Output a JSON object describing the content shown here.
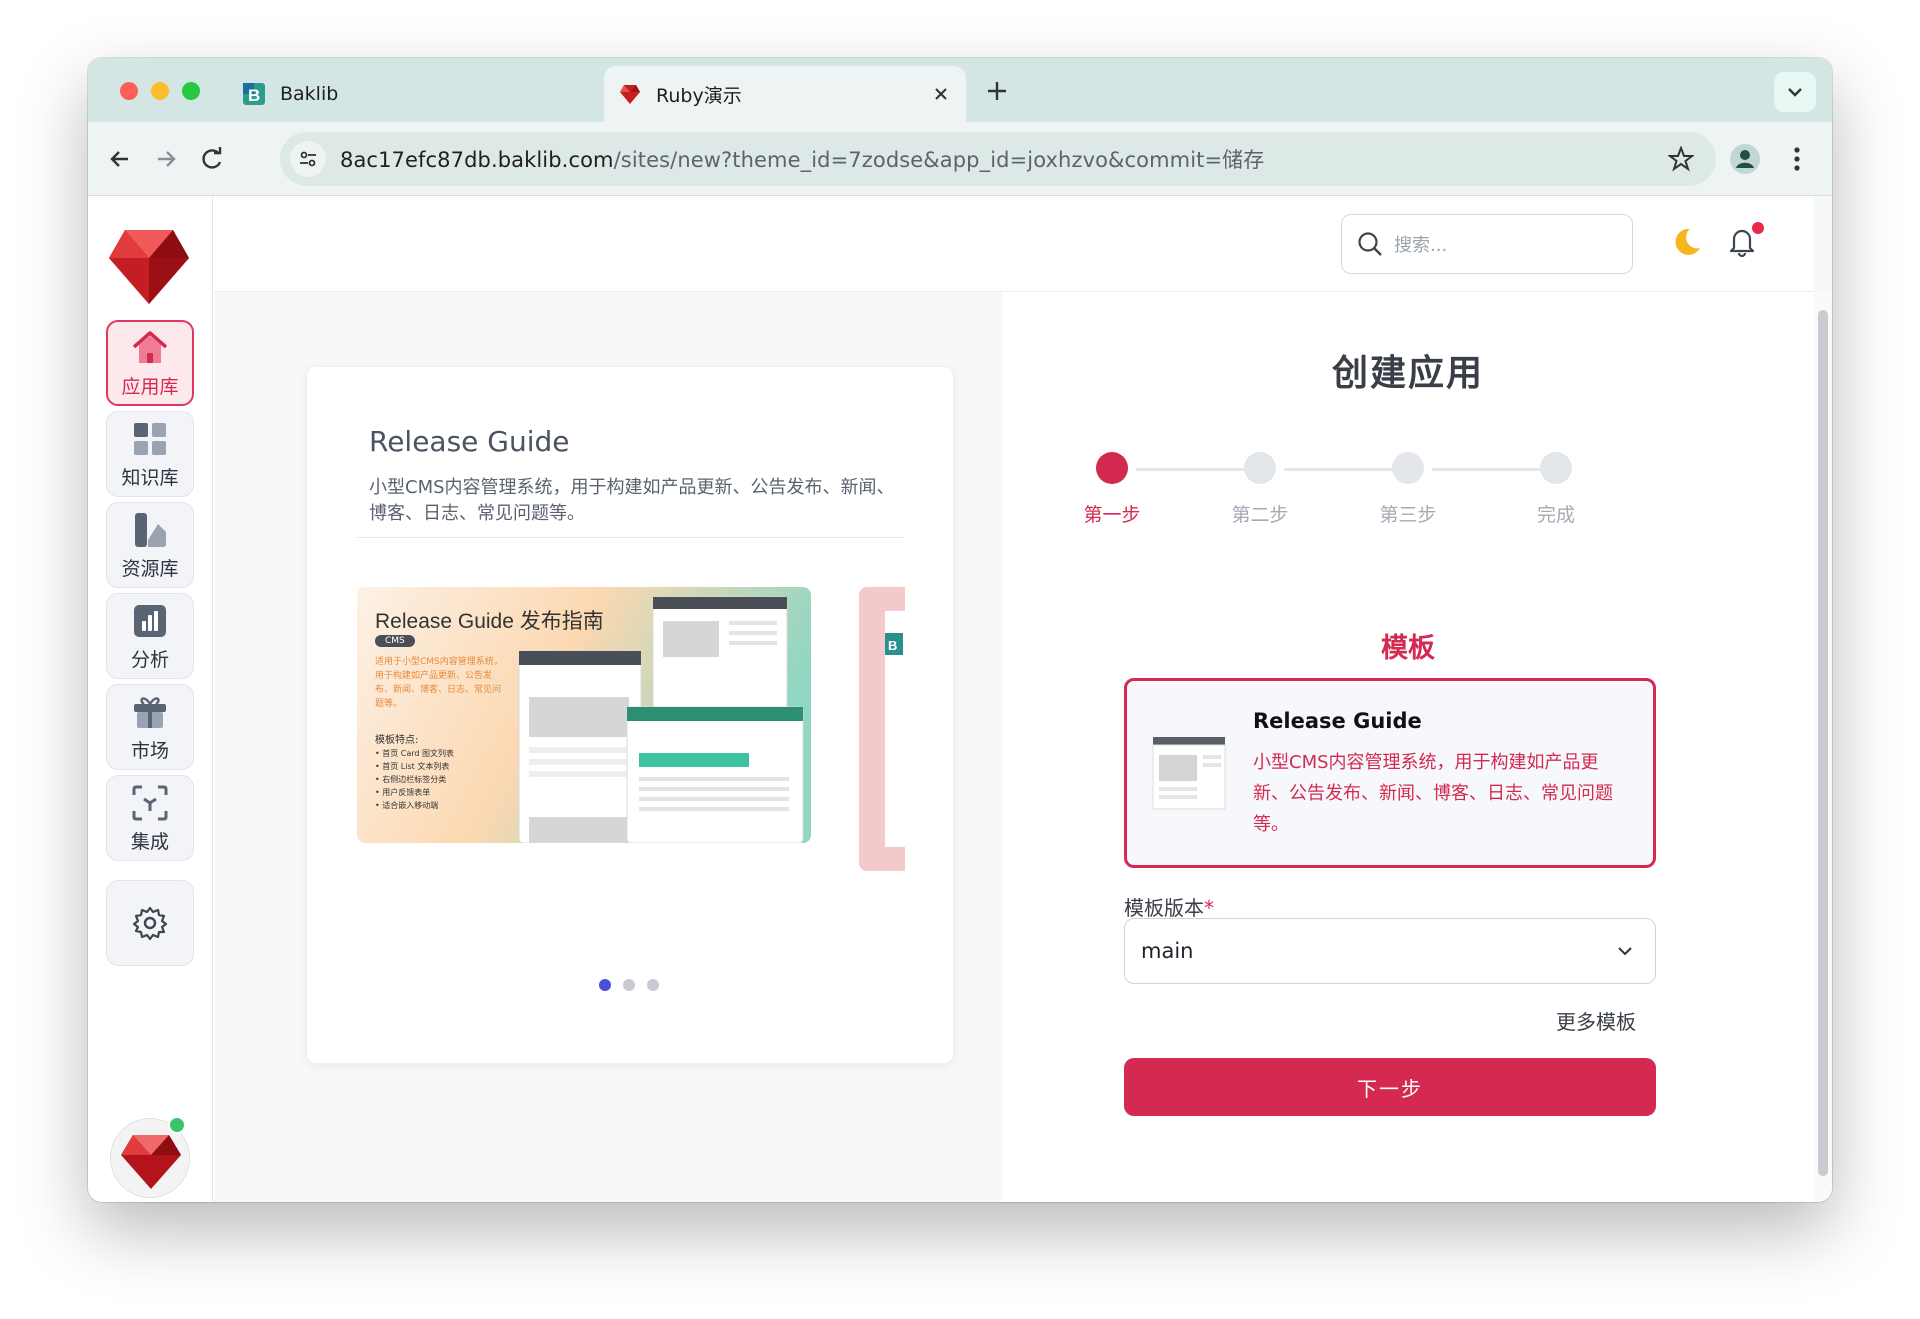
{
  "browser": {
    "tabs": [
      {
        "title": "Baklib",
        "active": false
      },
      {
        "title": "Ruby演示",
        "active": true
      }
    ],
    "url_host": "8ac17efc87db.baklib.com",
    "url_path": "/sites/new?theme_id=7zodse&app_id=joxhzvo&commit=储存"
  },
  "sidebar": {
    "items": [
      {
        "label": "应用库",
        "icon": "home-icon",
        "active": true
      },
      {
        "label": "知识库",
        "icon": "grid-icon",
        "active": false
      },
      {
        "label": "资源库",
        "icon": "assets-icon",
        "active": false
      },
      {
        "label": "分析",
        "icon": "chart-icon",
        "active": false
      },
      {
        "label": "市场",
        "icon": "gift-icon",
        "active": false
      },
      {
        "label": "集成",
        "icon": "integration-icon",
        "active": false
      }
    ]
  },
  "header": {
    "search_placeholder": "搜索..."
  },
  "preview_card": {
    "title": "Release Guide",
    "description": "小型CMS内容管理系统，用于构建如产品更新、公告发布、新闻、博客、日志、常见问题等。",
    "carousel": {
      "slide_title": "Release Guide 发布指南",
      "badge": "CMS",
      "slide_text": "适用于小型CMS内容管理系统，用于构建如产品更新、公告发布、新闻、博客、日志、常见问题等。",
      "features_title": "模板特点:",
      "features": [
        "首页 Card 图文列表",
        "首页 List 文本列表",
        "右侧边栏标签分类",
        "用户反馈表单",
        "适合嵌入移动端"
      ],
      "current_slide": 1,
      "total_slides": 3
    }
  },
  "wizard": {
    "title": "创建应用",
    "steps": [
      {
        "label": "第一步",
        "active": true
      },
      {
        "label": "第二步",
        "active": false
      },
      {
        "label": "第三步",
        "active": false
      },
      {
        "label": "完成",
        "active": false
      }
    ],
    "section_title": "模板",
    "template": {
      "name": "Release Guide",
      "description": "小型CMS内容管理系统，用于构建如产品更新、公告发布、新闻、博客、日志、常见问题等。"
    },
    "version_label": "模板版本",
    "version_required_mark": "*",
    "version_value": "main",
    "more_templates": "更多模板",
    "next_button": "下一步"
  },
  "colors": {
    "accent": "#d42a52",
    "tab_bar": "#d3e6e3",
    "carousel_active_dot": "#4b4fd8"
  }
}
